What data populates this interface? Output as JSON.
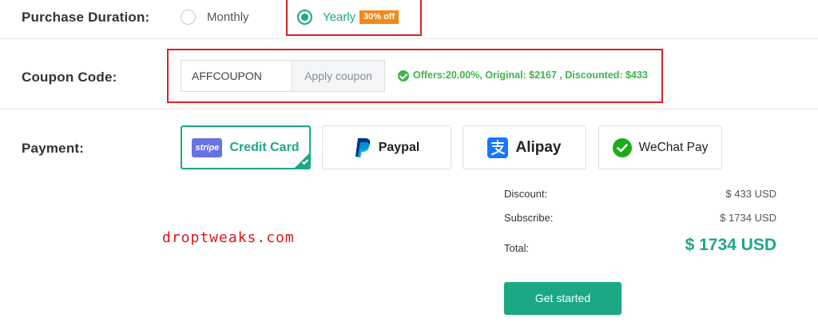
{
  "duration": {
    "label": "Purchase Duration:",
    "options": [
      {
        "label": "Monthly",
        "selected": false
      },
      {
        "label": "Yearly",
        "selected": true,
        "badge": "30% off"
      }
    ]
  },
  "coupon": {
    "label": "Coupon Code:",
    "value": "AFFCOUPON",
    "apply_label": "Apply coupon",
    "offer_text": "Offers:20.00%, Original: $2167 , Discounted: $433"
  },
  "payment": {
    "label": "Payment:",
    "methods": [
      {
        "name": "Credit Card",
        "logo_text": "stripe",
        "icon": "stripe-logo",
        "selected": true
      },
      {
        "name": "Paypal",
        "icon": "paypal-icon",
        "selected": false
      },
      {
        "name": "Alipay",
        "icon": "alipay-icon",
        "selected": false
      },
      {
        "name": "WeChat Pay",
        "icon": "wechat-icon",
        "selected": false
      }
    ]
  },
  "summary": {
    "discount_label": "Discount:",
    "discount_value": "$ 433 USD",
    "subscribe_label": "Subscribe:",
    "subscribe_value": "$ 1734 USD",
    "total_label": "Total:",
    "total_value": "$ 1734 USD"
  },
  "cta": {
    "label": "Get started"
  },
  "watermark": "droptweaks.com",
  "colors": {
    "accent": "#1aa885",
    "badge": "#f08a1c",
    "success": "#3fb44a",
    "highlight_border": "#d8232a",
    "watermark": "#e0151b"
  }
}
